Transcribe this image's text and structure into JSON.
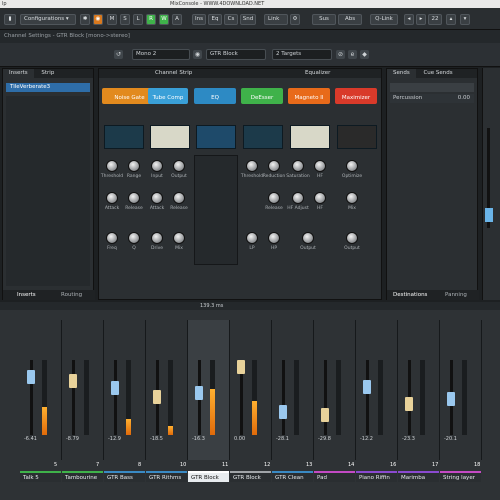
{
  "window": {
    "title": "MixConsole - WWW.4DOWNLOAD.NET",
    "menu_fragment": "lp"
  },
  "toolbar": {
    "configurations": "Configurations",
    "buttons": [
      "M",
      "S",
      "L",
      "R",
      "W",
      "A"
    ],
    "view_buttons": [
      "Ins",
      "Eq",
      "Cs",
      "Snd"
    ],
    "link": "Link",
    "sus": "Sus",
    "abs": "Abs",
    "qlink": "Q-Link",
    "zoom_value": "22"
  },
  "settings_bar": {
    "text": "Channel Settings - GTR Block [mono->stereo]"
  },
  "routing": {
    "input": "Mono 2",
    "channel": "GTR Block",
    "output": "2 Targets"
  },
  "inserts": {
    "tab_inserts": "Inserts",
    "tab_strip": "Strip",
    "slot1": "TileVerberate3",
    "bottom_inserts": "Inserts",
    "bottom_routing": "Routing"
  },
  "channel_strip": {
    "header": "Channel Strip",
    "modules": [
      "Noise Gate",
      "Tube Comp",
      "EQ",
      "DeEsser",
      "Magneto II",
      "Maximizer"
    ],
    "module_colors": [
      "#e28a1e",
      "#3aa0d8",
      "#2d8ac4",
      "#3fb24a",
      "#e86a1a",
      "#d93a2a"
    ],
    "knob_labels": [
      "Threshold",
      "Range",
      "Input",
      "Output",
      "Threshold",
      "Reduction",
      "Saturation",
      "HF",
      "Optimize"
    ],
    "knob_labels2": [
      "Attack",
      "Release",
      "Attack",
      "Release",
      "Release",
      "HF Adjust",
      "HF",
      "Mix"
    ],
    "knob_labels3": [
      "Freq",
      "Q",
      "Drive",
      "Mix",
      "LP",
      "HP",
      "Output",
      "Output"
    ]
  },
  "equalizer": {
    "header": "Equalizer"
  },
  "sends": {
    "tab_sends": "Sends",
    "tab_cue": "Cue Sends",
    "send1": "Percussion",
    "send1_value": "0.00",
    "bottom_dest": "Destinations",
    "bottom_panning": "Panning"
  },
  "transport": {
    "time": "139.3 ms"
  },
  "mixer": {
    "channels": [
      {
        "num": "5",
        "name": "Talk 5",
        "vol": "-6.41",
        "color": "#3fb24a",
        "level": 0.38
      },
      {
        "num": "7",
        "name": "Tambourine",
        "vol": "-8.79",
        "color": "#3fb24a",
        "level": 0.0
      },
      {
        "num": "8",
        "name": "GTR Bass",
        "vol": "-12.9",
        "color": "#3a8ac4",
        "level": 0.22
      },
      {
        "num": "10",
        "name": "GTR Rithms",
        "vol": "-18.5",
        "color": "#3a8ac4",
        "level": 0.12
      },
      {
        "num": "11",
        "name": "GTR Block",
        "vol": "-16.3",
        "color": "#ffffff",
        "level": 0.62
      },
      {
        "num": "12",
        "name": "GTR Block",
        "vol": "0.00",
        "color": "#a0a4a8",
        "level": 0.45
      },
      {
        "num": "13",
        "name": "GTR Clean",
        "vol": "-28.1",
        "color": "#3a8ac4",
        "level": 0.0
      },
      {
        "num": "14",
        "name": "Pad",
        "vol": "-29.8",
        "color": "#c34ac4",
        "level": 0.0
      },
      {
        "num": "16",
        "name": "Piano Riffin",
        "vol": "-12.2",
        "color": "#8a4ad0",
        "level": 0.0
      },
      {
        "num": "17",
        "name": "Marimba",
        "vol": "-23.3",
        "color": "#8a4ad0",
        "level": 0.0
      },
      {
        "num": "18",
        "name": "String layer",
        "vol": "-20.1",
        "color": "#c44ac4",
        "level": 0.0
      }
    ]
  },
  "colors": {
    "accent_green": "#3fb24a",
    "accent_orange": "#d9791e",
    "meter": "#e06a0a"
  }
}
